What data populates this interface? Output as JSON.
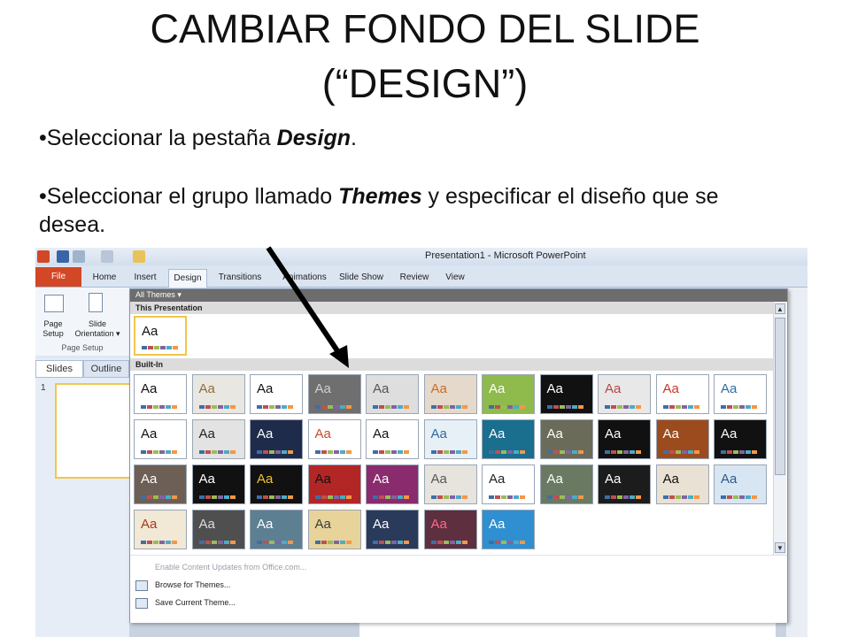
{
  "slide": {
    "title_line1": "CAMBIAR FONDO DEL SLIDE",
    "title_line2": "(“DESIGN”)",
    "bullet1": {
      "prefix": "•Seleccionar la pestaña ",
      "emphasis": "Design",
      "suffix": "."
    },
    "bullet2": {
      "prefix": "•Seleccionar el grupo llamado ",
      "emphasis": "Themes",
      "suffix": " y especificar el diseño que se desea."
    }
  },
  "window": {
    "title": "Presentation1 - Microsoft PowerPoint"
  },
  "ribbon": {
    "tabs": [
      {
        "label": "File"
      },
      {
        "label": "Home"
      },
      {
        "label": "Insert"
      },
      {
        "label": "Design"
      },
      {
        "label": "Transitions"
      },
      {
        "label": "Animations"
      },
      {
        "label": "Slide Show"
      },
      {
        "label": "Review"
      },
      {
        "label": "View"
      }
    ],
    "page_setup_label": "Page Setup",
    "slide_orientation_label": "Slide Orientation ▾",
    "group_label": "Page Setup"
  },
  "left_panel": {
    "tab_slides": "Slides",
    "tab_outline": "Outline",
    "slide_number": "1"
  },
  "gallery": {
    "filter_label": "All Themes ▾",
    "section_this": "This Presentation",
    "section_builtin": "Built-In",
    "theme_text": "Aa",
    "menu": {
      "enable_updates": "Enable Content Updates from Office.com...",
      "browse": "Browse for Themes...",
      "save": "Save Current Theme..."
    }
  },
  "colors": {
    "file_tab": "#d24726",
    "selection": "#f2c64b",
    "arrow": "#000000"
  },
  "icons": [
    "powerpoint-icon",
    "save-icon",
    "undo-icon",
    "redo-icon",
    "page-setup-icon",
    "slide-orientation-icon",
    "browse-icon",
    "save-theme-icon",
    "arrow-annotation"
  ]
}
